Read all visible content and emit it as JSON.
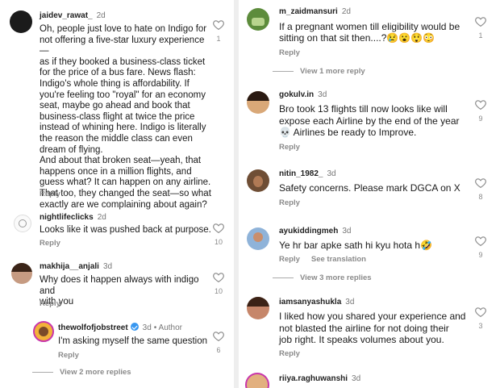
{
  "left": {
    "comments": [
      {
        "username": "jaidev_rawat_",
        "time": "2d",
        "text": "Oh, people just love to hate on Indigo for\nnot offering a five-star luxury experience—\nas if they booked a business-class ticket\nfor the price of a bus fare. News flash:\nIndigo's whole thing is affordability. If\nyou're feeling too \"royal\" for an economy\nseat, maybe go ahead and book that\nbusiness-class flight at twice the price\ninstead of whining here. Indigo is literally\nthe reason the middle class can even\ndream of flying.\nAnd about that broken seat—yeah, that\nhappens once in a million flights, and\nguess what? It can happen on any airline.\nThat too, they changed the seat—so what\nexactly are we complaining about again?",
        "reply": "Reply",
        "likes": "1"
      },
      {
        "username": "nightlifeclicks",
        "time": "2d",
        "text": "Looks like it was pushed back at purpose.",
        "reply": "Reply",
        "likes": "10"
      },
      {
        "username": "makhija__anjali",
        "time": "3d",
        "text": "Why does it happen always with indigo and\nwith you",
        "reply": "Reply",
        "likes": "10"
      },
      {
        "username": "thewolfofjobstreet",
        "time": "3d",
        "author": "• Author",
        "text": "I'm asking myself the same question",
        "reply": "Reply",
        "likes": "6"
      }
    ],
    "view_more": "View 2 more replies"
  },
  "right": {
    "comments": [
      {
        "username": "m_zaidmansuri",
        "time": "2d",
        "text": "If a pregnant women till eligibility would be\nsitting on that sit then....?😢😮😲😳",
        "reply": "Reply",
        "likes": "1"
      },
      {
        "username": "gokulv.in",
        "time": "3d",
        "text": "Bro took 13 flights till now looks like will\nexpose each Airline by the end of the year\n💀 Airlines be ready to Improve.",
        "reply": "Reply",
        "likes": "9"
      },
      {
        "username": "nitin_1982_",
        "time": "3d",
        "text": "Safety concerns. Please mark DGCA on X",
        "reply": "Reply",
        "likes": "8"
      },
      {
        "username": "ayukiddingmeh",
        "time": "3d",
        "text": "Ye hr bar apke sath hi kyu hota h🤣",
        "reply": "Reply",
        "translation": "See translation",
        "likes": "9"
      },
      {
        "username": "iamsanyashukla",
        "time": "3d",
        "text": "I liked how you shared your experience and\nnot blasted the airline for not doing their\njob right. It speaks volumes about you.",
        "reply": "Reply",
        "likes": "3"
      },
      {
        "username": "riiya.raghuwanshi",
        "time": "3d"
      }
    ],
    "view_more_1": "View 1 more reply",
    "view_more_2": "View 3 more replies"
  },
  "icons": {
    "like": "heart-outline-icon",
    "verified": "verified-badge-icon"
  },
  "colors": {
    "muted": "#8a8a8a",
    "verified": "#3897f0",
    "story_ring": "#c837ab"
  }
}
